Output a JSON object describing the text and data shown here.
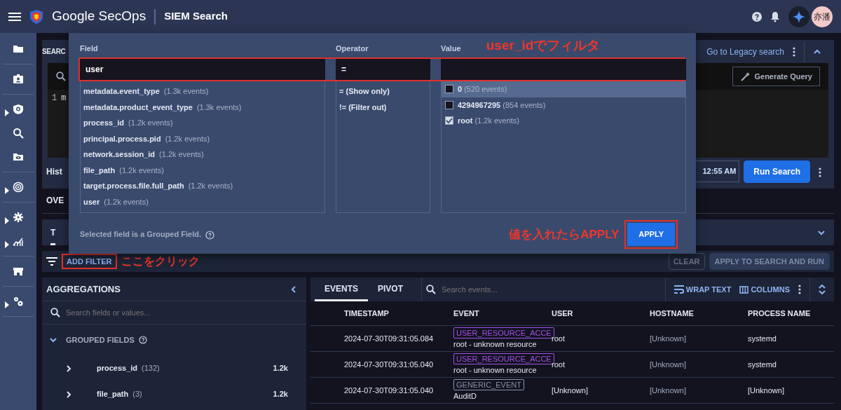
{
  "app": {
    "brand": "Google SecOps",
    "page_title": "SIEM Search",
    "avatar": "亦潘"
  },
  "search_panel": {
    "title": "SEARC",
    "legacy_link": "Go to Legacy search",
    "line_number": "1",
    "editor_text": "m",
    "generate_button": "Generate Query",
    "history_label": "Hist",
    "time": "12:55 AM",
    "run_button": "Run Search"
  },
  "results_tab": "OVE",
  "card_tab": "T",
  "filter_bar": {
    "add_filter": "ADD FILTER",
    "clear": "CLEAR",
    "apply_run": "APPLY TO SEARCH AND RUN"
  },
  "aggregations": {
    "title": "AGGREGATIONS",
    "search_placeholder": "Search fields or values...",
    "group_label": "GROUPED FIELDS",
    "group_expanded": true,
    "fields": [
      {
        "name": "process_id",
        "count": "(132)",
        "total": "1.2k"
      },
      {
        "name": "file_path",
        "count": "(3)",
        "total": "1.2k"
      }
    ]
  },
  "events": {
    "tabs": [
      {
        "label": "EVENTS",
        "selected": true
      },
      {
        "label": "PIVOT",
        "selected": false
      }
    ],
    "search_placeholder": "Search events...",
    "wrap_text": "WRAP TEXT",
    "columns_button": "COLUMNS",
    "columns": [
      "TIMESTAMP",
      "EVENT",
      "USER",
      "HOSTNAME",
      "PROCESS NAME"
    ],
    "rows": [
      {
        "timestamp": "2024-07-30T09:31:05.084",
        "event_type": "USER_RESOURCE_ACCE",
        "color": "#a64ee8",
        "event_desc": "root - unknown resource",
        "user": "root",
        "hostname": "[Unknown]",
        "process": "systemd"
      },
      {
        "timestamp": "2024-07-30T09:31:05.040",
        "event_type": "USER_RESOURCE_ACCE",
        "color": "#a64ee8",
        "event_desc": "root - unknown resource",
        "user": "root",
        "hostname": "[Unknown]",
        "process": "systemd"
      },
      {
        "timestamp": "2024-07-30T09:31:05.040",
        "event_type": "GENERIC_EVENT",
        "color": "#8a93a8",
        "event_desc": "AuditD",
        "user": "[Unknown]",
        "hostname": "[Unknown]",
        "process": "[Unknown]"
      }
    ]
  },
  "filter_dialog": {
    "field_label": "Field",
    "operator_label": "Operator",
    "value_label": "Value",
    "field_value": "user",
    "operator_value": "=",
    "fields": [
      {
        "name": "metadata.event_type",
        "count": "(1.3k events)"
      },
      {
        "name": "metadata.product_event_type",
        "count": "(1.3k events)"
      },
      {
        "name": "process_id",
        "count": "(1.2k events)"
      },
      {
        "name": "principal.process.pid",
        "count": "(1.2k events)"
      },
      {
        "name": "network.session_id",
        "count": "(1.2k events)"
      },
      {
        "name": "file_path",
        "count": "(1.2k events)"
      },
      {
        "name": "target.process.file.full_path",
        "count": "(1.2k events)"
      },
      {
        "name": "user",
        "count": "(1.2k events)"
      }
    ],
    "operators": [
      {
        "symbol": "=",
        "meaning": "(Show only)"
      },
      {
        "symbol": "!=",
        "meaning": "(Filter out)"
      }
    ],
    "values": [
      {
        "name": "0",
        "count": "(520 events)",
        "checked": false,
        "selected": true
      },
      {
        "name": "4294967295",
        "count": "(854 events)",
        "checked": false,
        "selected": false
      },
      {
        "name": "root",
        "count": "(1.2k events)",
        "checked": true,
        "selected": false
      }
    ],
    "note": "Selected field is a Grouped Field.",
    "apply_button": "APPLY"
  },
  "annotations": {
    "filter_hint": "user_idでフィルタ",
    "apply_hint": "値を入れたらAPPLY",
    "click_hint": "ここをクリック"
  }
}
